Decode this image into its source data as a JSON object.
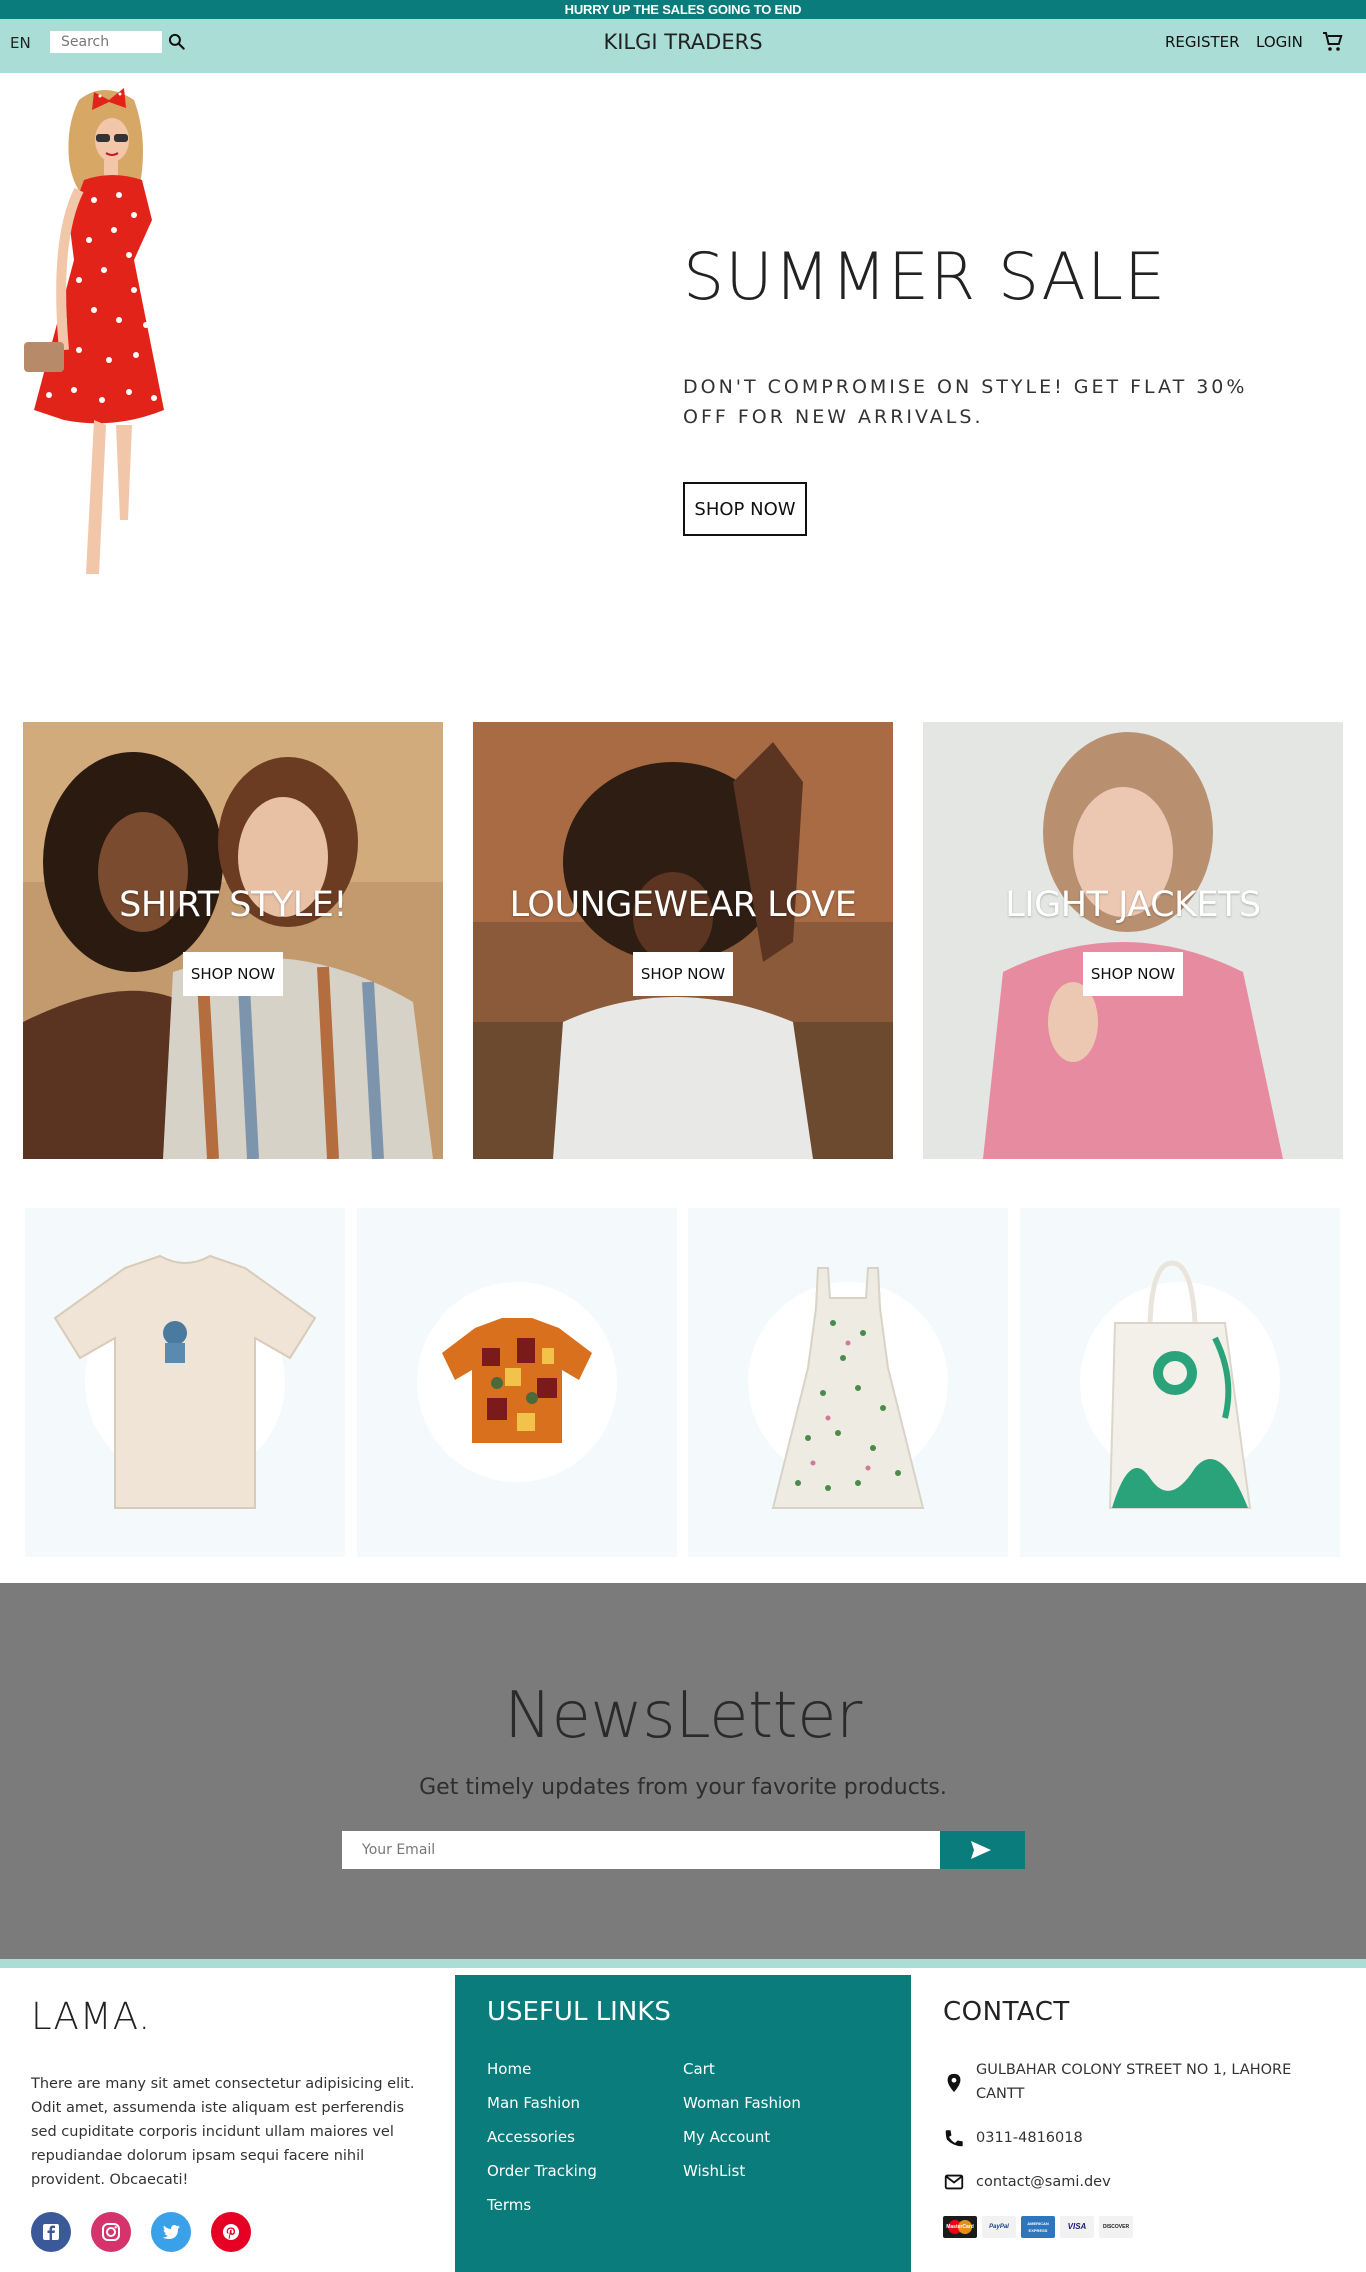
{
  "announcement": "HURRY UP THE SALES GOING TO END",
  "navbar": {
    "language": "EN",
    "search_placeholder": "Search",
    "brand": "KILGI TRADERS",
    "register": "REGISTER",
    "login": "LOGIN"
  },
  "hero": {
    "title": "SUMMER SALE",
    "description": "DON'T COMPROMISE ON STYLE! GET FLAT 30% OFF FOR NEW ARRIVALS.",
    "button": "SHOP NOW"
  },
  "categories": [
    {
      "title": "SHIRT STYLE!",
      "button": "SHOP NOW"
    },
    {
      "title": "LOUNGEWEAR LOVE",
      "button": "SHOP NOW"
    },
    {
      "title": "LIGHT JACKETS",
      "button": "SHOP NOW"
    }
  ],
  "products": [
    {
      "icon": "tshirt-image"
    },
    {
      "icon": "printed-shirt-image"
    },
    {
      "icon": "floral-dress-image"
    },
    {
      "icon": "tote-bag-image"
    }
  ],
  "newsletter": {
    "title": "NewsLetter",
    "description": "Get timely updates from your favorite products.",
    "email_placeholder": "Your Email"
  },
  "footer": {
    "logo": "LAMA.",
    "description": "There are many sit amet consectetur adipisicing elit. Odit amet, assumenda iste aliquam est perferendis sed cupiditate corporis incidunt ullam maiores vel repudiandae dolorum ipsam sequi facere nihil provident. Obcaecati!",
    "useful_links_title": "USEFUL LINKS",
    "links_left": [
      "Home",
      "Man Fashion",
      "Accessories",
      "Order Tracking",
      "Terms"
    ],
    "links_right": [
      "Cart",
      "Woman Fashion",
      "My Account",
      "WishList"
    ],
    "contact_title": "CONTACT",
    "address": "GULBAHAR COLONY STREET NO 1, LAHORE CANTT",
    "phone": "0311-4816018",
    "email": "contact@sami.dev",
    "payments": [
      "MasterCard",
      "PayPal",
      "AMERICAN EXPRESS",
      "VISA",
      "DISCOVER"
    ]
  },
  "colors": {
    "teal": "#0b7c7c",
    "mint": "#a9ddd6",
    "newsletter_bg": "#7b7b7b",
    "product_bg": "#f4f9fc"
  }
}
